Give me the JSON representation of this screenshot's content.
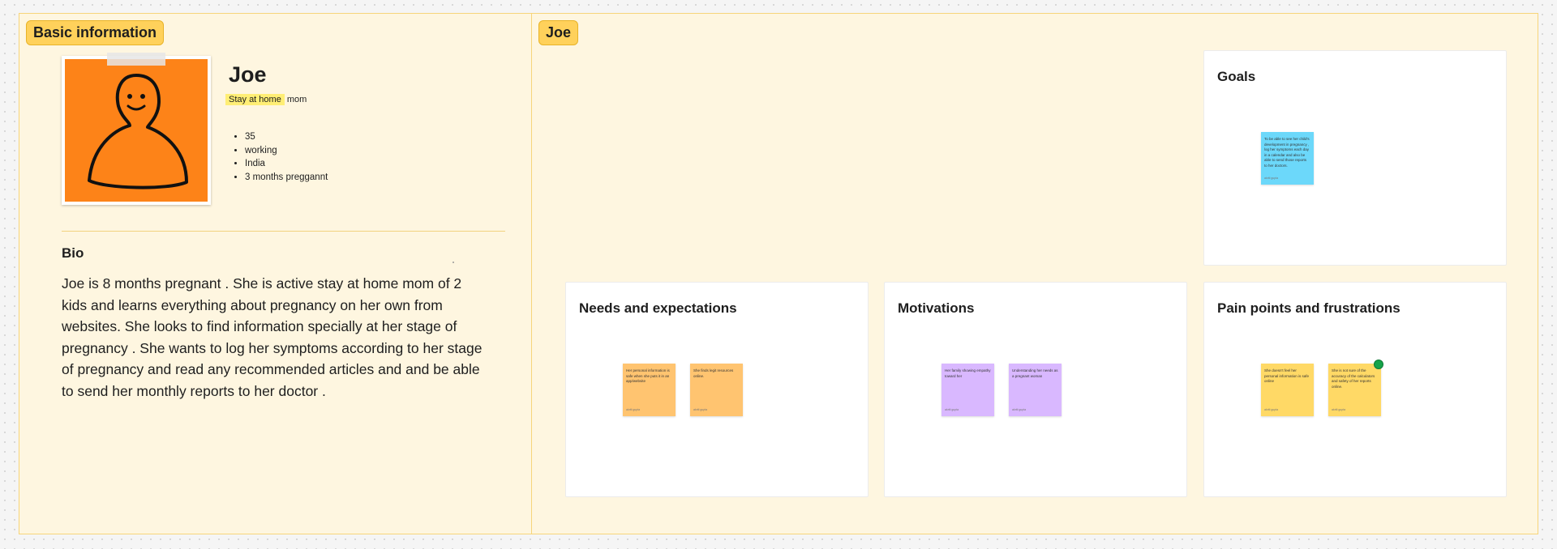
{
  "basic_section": {
    "label": "Basic information",
    "persona": {
      "name": "Joe",
      "role_highlight": "Stay at home",
      "role_rest": " mom",
      "attributes": [
        "35",
        "working",
        "India",
        "3 months preggannt"
      ]
    },
    "bio": {
      "title": "Bio",
      "text": "Joe is 8 months pregnant . She is active stay at home mom of 2 kids and learns everything about pregnancy on her own from websites. She looks to find information specially at her stage of pregnancy . She wants to log her symptoms according to her stage of pregnancy and read any recommended articles and and be able to send her monthly reports to her doctor ."
    }
  },
  "joe_section": {
    "label": "Joe",
    "cards": {
      "goals": {
        "title": "Goals",
        "notes": [
          {
            "text": "To be able to see her child's development in pregnancy , log her symptoms each day in a calendar and also be able to send those reports to her doctors.",
            "author": "akriti gupta",
            "color": "#6cd8fa"
          }
        ]
      },
      "needs": {
        "title": "Needs and expectations",
        "notes": [
          {
            "text": "Her personal information is safe when she puts it in an app/website",
            "author": "akriti gupta",
            "color": "#ffc470"
          },
          {
            "text": "She finds legit resources online.",
            "author": "akriti gupta",
            "color": "#ffc470"
          }
        ]
      },
      "motivations": {
        "title": "Motivations",
        "notes": [
          {
            "text": "Her family showing empathy toward her",
            "author": "akriti gupta",
            "color": "#d9b8ff"
          },
          {
            "text": "Understanding her needs as a pregnant woman",
            "author": "akriti gupta",
            "color": "#d9b8ff"
          }
        ]
      },
      "pain_points": {
        "title": "Pain points and frustrations",
        "notes": [
          {
            "text": "She doesn't feel her personal information is safe online",
            "author": "akriti gupta",
            "color": "#ffd966"
          },
          {
            "text": "She is not sure of the accuracy of the calculators and safety of her reports online.",
            "author": "akriti gupta",
            "color": "#ffd966"
          }
        ]
      }
    }
  }
}
